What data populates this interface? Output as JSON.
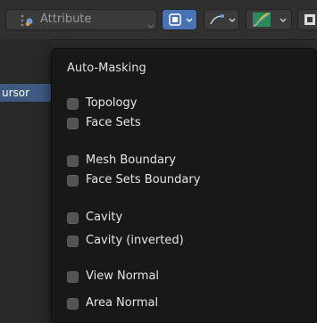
{
  "header": {
    "attribute_label": "Attribute"
  },
  "sidebar": {
    "cursor_label": "ursor"
  },
  "popup": {
    "title": "Auto-Masking",
    "options": [
      {
        "label": "Topology",
        "checked": false
      },
      {
        "label": "Face Sets",
        "checked": false
      },
      {
        "label": "Mesh Boundary",
        "checked": false
      },
      {
        "label": "Face Sets Boundary",
        "checked": false
      },
      {
        "label": "Cavity",
        "checked": false
      },
      {
        "label": "Cavity (inverted)",
        "checked": false
      },
      {
        "label": "View Normal",
        "checked": false
      },
      {
        "label": "Area Normal",
        "checked": false
      }
    ]
  },
  "colors": {
    "accent": "#4772b3",
    "popup_bg": "#181818",
    "checkbox": "#545454"
  },
  "icons": [
    "attribute-icon",
    "mask-icon",
    "dyntopo-icon",
    "curve-icon",
    "chevron-down-icon"
  ]
}
